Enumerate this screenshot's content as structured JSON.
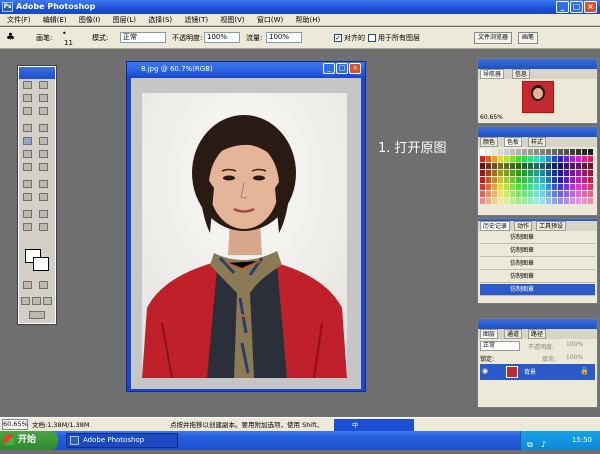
{
  "window": {
    "title": "Adobe Photoshop"
  },
  "menu": [
    "文件(F)",
    "编辑(E)",
    "图像(I)",
    "图层(L)",
    "选择(S)",
    "滤镜(T)",
    "视图(V)",
    "窗口(W)",
    "帮助(H)"
  ],
  "options": {
    "brush_label": "画笔:",
    "brush_size": "11",
    "mode_label": "模式:",
    "mode_value": "正常",
    "opacity_label": "不透明度:",
    "opacity_value": "100%",
    "flow_label": "流量:",
    "flow_value": "100%",
    "aligned_label": "对齐的",
    "all_layers_label": "用于所有图层"
  },
  "palette_well": {
    "tab1": "文件浏览器",
    "tab2": "画笔"
  },
  "document": {
    "title": "8.jpg @ 60.7%(RGB)"
  },
  "caption": "1. 打开原图",
  "navigator": {
    "tabs": [
      "导航器",
      "信息"
    ],
    "zoom": "60.65%"
  },
  "color_panel": {
    "tabs": [
      "颜色",
      "色板",
      "样式"
    ]
  },
  "history_panel": {
    "tabs": [
      "历史记录",
      "动作",
      "工具预设"
    ],
    "items": [
      "仿制图章",
      "仿制图章",
      "仿制图章",
      "仿制图章",
      "仿制图章"
    ]
  },
  "layers_panel": {
    "tabs": [
      "图层",
      "通道",
      "路径"
    ],
    "mode": "正常",
    "opacity_label": "不透明度:",
    "opacity": "100%",
    "lock_label": "锁定:",
    "fill_label": "填充:",
    "fill": "100%",
    "layer_name": "背景"
  },
  "status": {
    "zoom": "60.65%",
    "doc": "文档:1.38M/1.38M",
    "hint": "点按并拖移以创建副本。要用附加选项，使用 Shift、"
  },
  "taskbar": {
    "start": "开始",
    "task": "Adobe Photoshop",
    "ime": "中",
    "clock": "15:50"
  }
}
